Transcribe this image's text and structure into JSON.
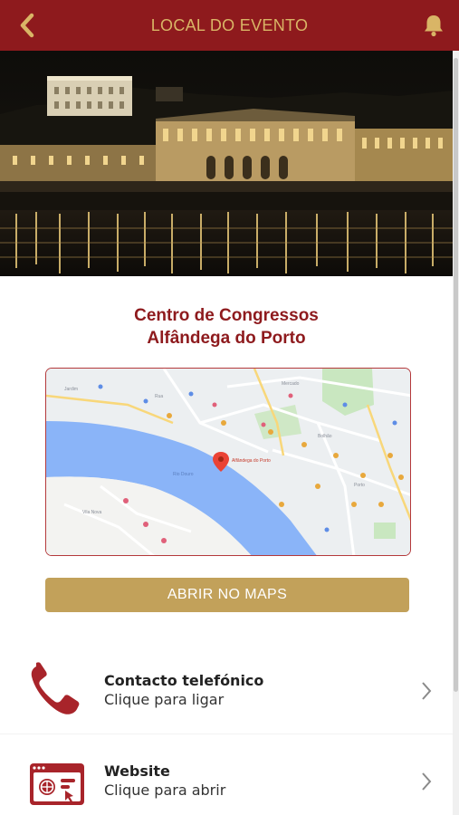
{
  "header": {
    "title": "LOCAL DO EVENTO",
    "back_icon": "chevron-left-icon",
    "bell_icon": "bell-icon",
    "bar_color": "#8e1a1d",
    "accent_color": "#d9b566"
  },
  "venue": {
    "name_line1": "Centro de Congressos",
    "name_line2": "Alfândega do Porto"
  },
  "map": {
    "river_label": "Rio Douro",
    "pin_label": "Alfândega do Porto"
  },
  "maps_button": {
    "label": "ABRIR NO MAPS",
    "color": "#c2a15a"
  },
  "contacts": [
    {
      "icon": "phone-icon",
      "title": "Contacto telefónico",
      "subtitle": "Clique para ligar"
    },
    {
      "icon": "website-icon",
      "title": "Website",
      "subtitle": "Clique para abrir"
    }
  ]
}
